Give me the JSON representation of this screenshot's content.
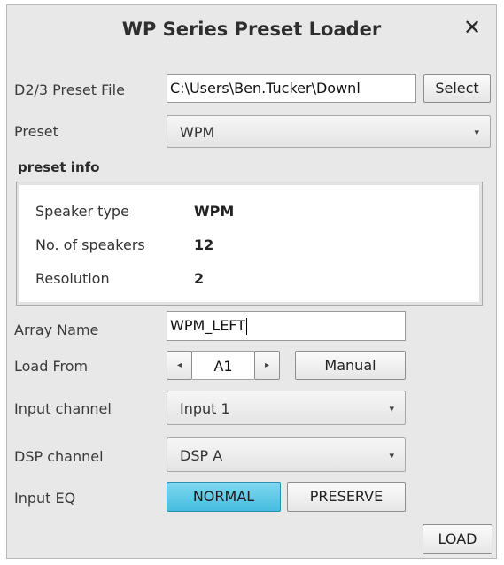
{
  "window": {
    "title": "WP Series Preset Loader",
    "close_glyph": "✕"
  },
  "preset_file": {
    "label": "D2/3 Preset File",
    "value": "C:\\Users\\Ben.Tucker\\Downl",
    "select_label": "Select"
  },
  "preset": {
    "label": "Preset",
    "selected": "WPM"
  },
  "preset_info": {
    "caption": "preset info",
    "rows": [
      {
        "key": "Speaker type",
        "value": "WPM"
      },
      {
        "key": "No. of speakers",
        "value": "12"
      },
      {
        "key": "Resolution",
        "value": "2"
      }
    ]
  },
  "array_name": {
    "label": "Array Name",
    "value": "WPM_LEFT"
  },
  "load_from": {
    "label": "Load From",
    "value": "A1",
    "prev_glyph": "◂",
    "next_glyph": "▸",
    "manual_label": "Manual"
  },
  "input_channel": {
    "label": "Input channel",
    "selected": "Input 1"
  },
  "dsp_channel": {
    "label": "DSP channel",
    "selected": "DSP A"
  },
  "input_eq": {
    "label": "Input EQ",
    "options": [
      "NORMAL",
      "PRESERVE"
    ],
    "selected": "NORMAL"
  },
  "load_button": "LOAD",
  "icons": {
    "dropdown": "▾"
  },
  "colors": {
    "accent": "#4cc3e4",
    "window_bg": "#e8e8e8"
  }
}
